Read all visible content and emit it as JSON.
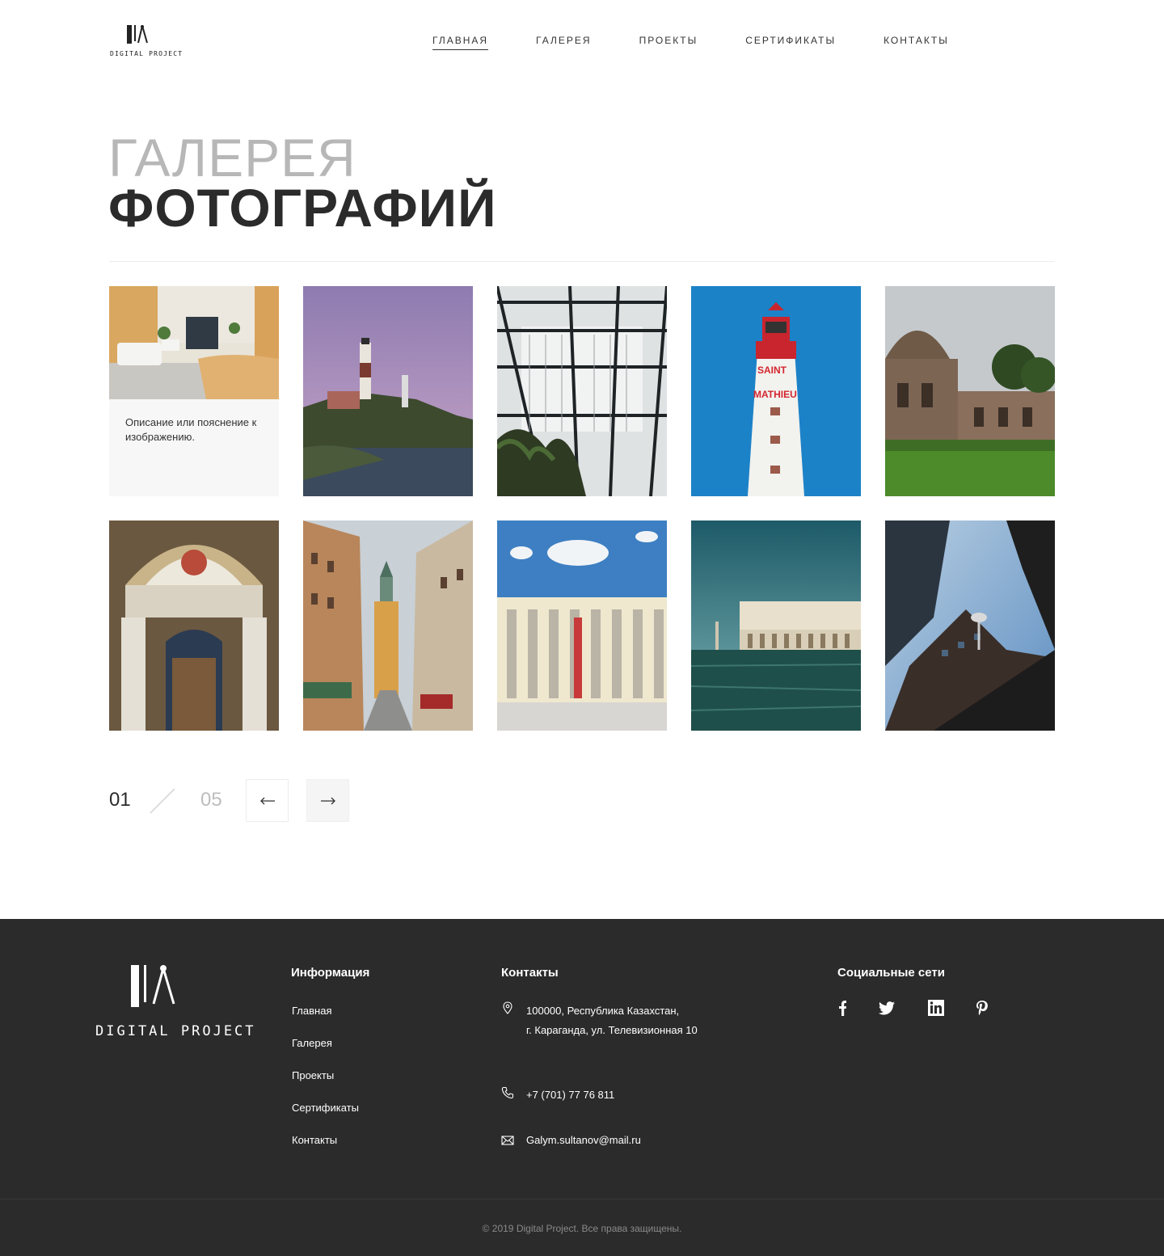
{
  "header": {
    "logo_text": "DIGITAL PROJECT",
    "nav": [
      {
        "label": "ГЛАВНАЯ",
        "active": true
      },
      {
        "label": "ГАЛЕРЕЯ",
        "active": false
      },
      {
        "label": "ПРОЕКТЫ",
        "active": false
      },
      {
        "label": "СЕРТИФИКАТЫ",
        "active": false
      },
      {
        "label": "КОНТАКТЫ",
        "active": false
      }
    ]
  },
  "title": {
    "light": "ГАЛЕРЕЯ",
    "bold": "ФОТОГРАФИЙ"
  },
  "gallery": {
    "first_caption": "Описание или пояснение к изображению.",
    "images": [
      "lobby-photo",
      "lighthouse-cliff-photo",
      "glass-roof-photo",
      "lighthouse-red-photo",
      "domed-tomb-photo",
      "church-interior-photo",
      "old-town-street-photo",
      "colonnade-building-photo",
      "venice-palace-photo",
      "skyscrapers-photo"
    ]
  },
  "pager": {
    "current": "01",
    "total": "05",
    "prev_icon": "arrow-left-icon",
    "next_icon": "arrow-right-icon"
  },
  "footer": {
    "logo_text": "DIGITAL PROJECT",
    "info_title": "Информация",
    "info_links": [
      "Главная",
      "Галерея",
      "Проекты",
      "Сертификаты",
      "Контакты"
    ],
    "contacts_title": "Контакты",
    "address_line1": "100000, Республика  Казахстан,",
    "address_line2": "г. Караганда, ул. Телевизионная 10",
    "phone": "+7 (701) 77 76 811",
    "email": "Galym.sultanov@mail.ru",
    "social_title": "Социальные сети",
    "social": [
      "facebook-icon",
      "twitter-icon",
      "linkedin-icon",
      "pinterest-icon"
    ],
    "copyright": "© 2019 Digital Project. Все права защищены."
  },
  "colors": {
    "dark": "#2b2b2b",
    "light_title": "#b7b7b7",
    "footer_bg": "#2b2b2b"
  }
}
